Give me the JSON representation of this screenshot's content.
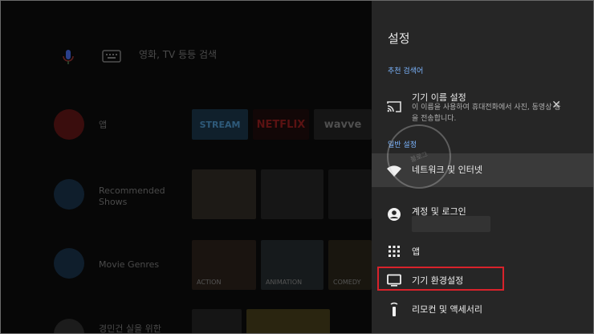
{
  "home": {
    "search_placeholder": "영화, TV 등등 검색",
    "rows": [
      {
        "label": "앱"
      },
      {
        "label": "Recommended Shows"
      },
      {
        "label": "Movie Genres"
      },
      {
        "label": "경민건 실을 위한"
      }
    ],
    "app_logos": [
      "STREAM",
      "NETFLIX",
      "wavve"
    ],
    "genre_tiles": [
      "ACTION",
      "ANIMATION",
      "COMEDY"
    ]
  },
  "settings": {
    "title": "설정",
    "suggested_header": "추천 검색어",
    "device_name": {
      "label": "기기 이름 설정",
      "description": "이 이름을 사용하여 휴대전화에서 사진, 동영상 등을 전송합니다.",
      "dismiss_icon": "close-icon"
    },
    "general_header": "일반 설정",
    "items": [
      {
        "label": "네트워크 및 인터넷",
        "icon": "wifi-icon"
      },
      {
        "label": "계정 및 로그인",
        "icon": "account-icon"
      },
      {
        "label": "앱",
        "icon": "apps-grid-icon"
      },
      {
        "label": "기기 환경설정",
        "icon": "tv-icon"
      },
      {
        "label": "리모컨 및 액세서리",
        "icon": "remote-icon"
      }
    ]
  },
  "watermark": "블로그",
  "colors": {
    "panel_bg": "#262626",
    "accent": "#7cb5ff",
    "highlight": "#d8222b"
  }
}
